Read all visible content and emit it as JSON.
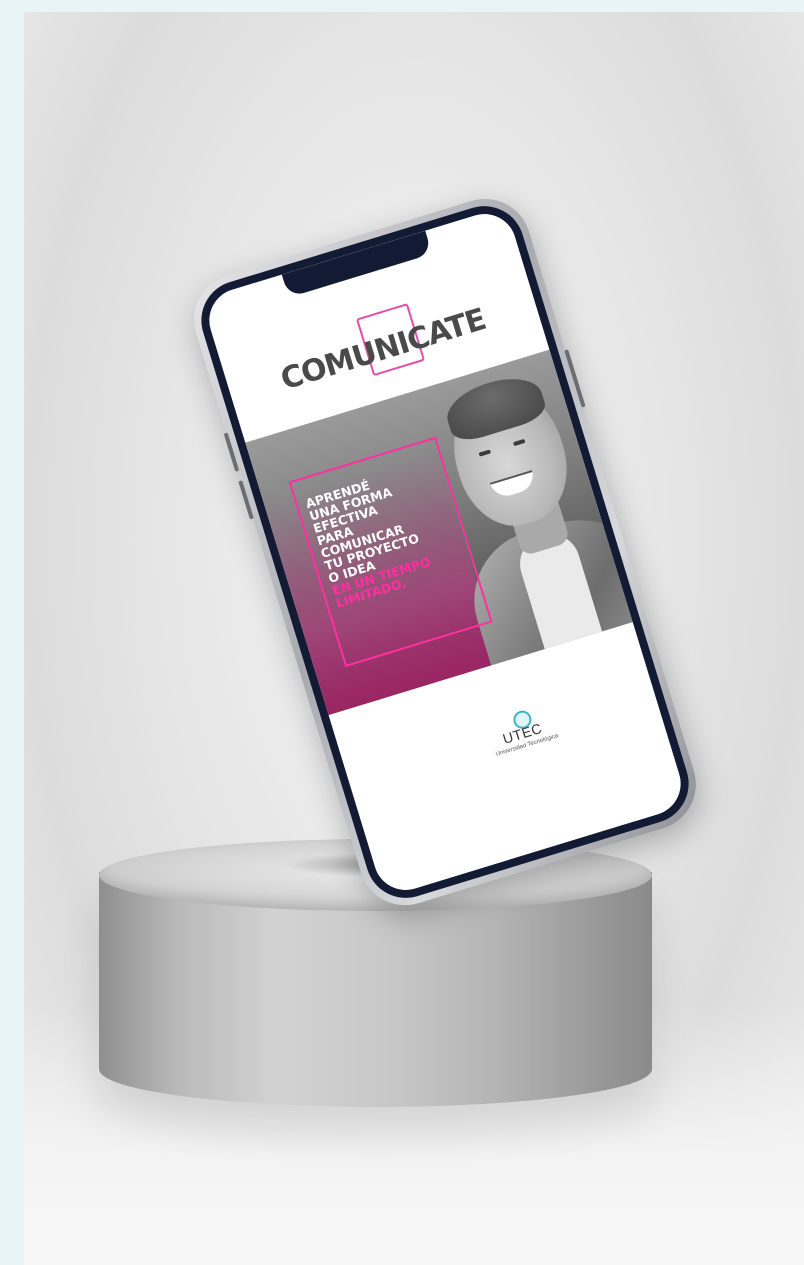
{
  "poster": {
    "title": "COMUNICATE",
    "tagline": [
      {
        "text": "APRENDÉ",
        "accent": false
      },
      {
        "text": "UNA FORMA",
        "accent": false
      },
      {
        "text": "EFECTIVA",
        "accent": false
      },
      {
        "text": "PARA",
        "accent": false
      },
      {
        "text": "COMUNICAR",
        "accent": false
      },
      {
        "text": "TU PROYECTO",
        "accent": false
      },
      {
        "text": "O IDEA",
        "accent": false
      },
      {
        "text": "EN UN TIEMPO",
        "accent": true
      },
      {
        "text": "LIMITADO.",
        "accent": true
      }
    ],
    "brand": {
      "name": "UTEC",
      "subtitle": "Universidad Tecnológica"
    }
  },
  "colors": {
    "accent_pink": "#ff2f9f",
    "phone_bezel": "#131a33",
    "brand_teal": "#39b7c8",
    "page_background": "#e8f4f5"
  }
}
